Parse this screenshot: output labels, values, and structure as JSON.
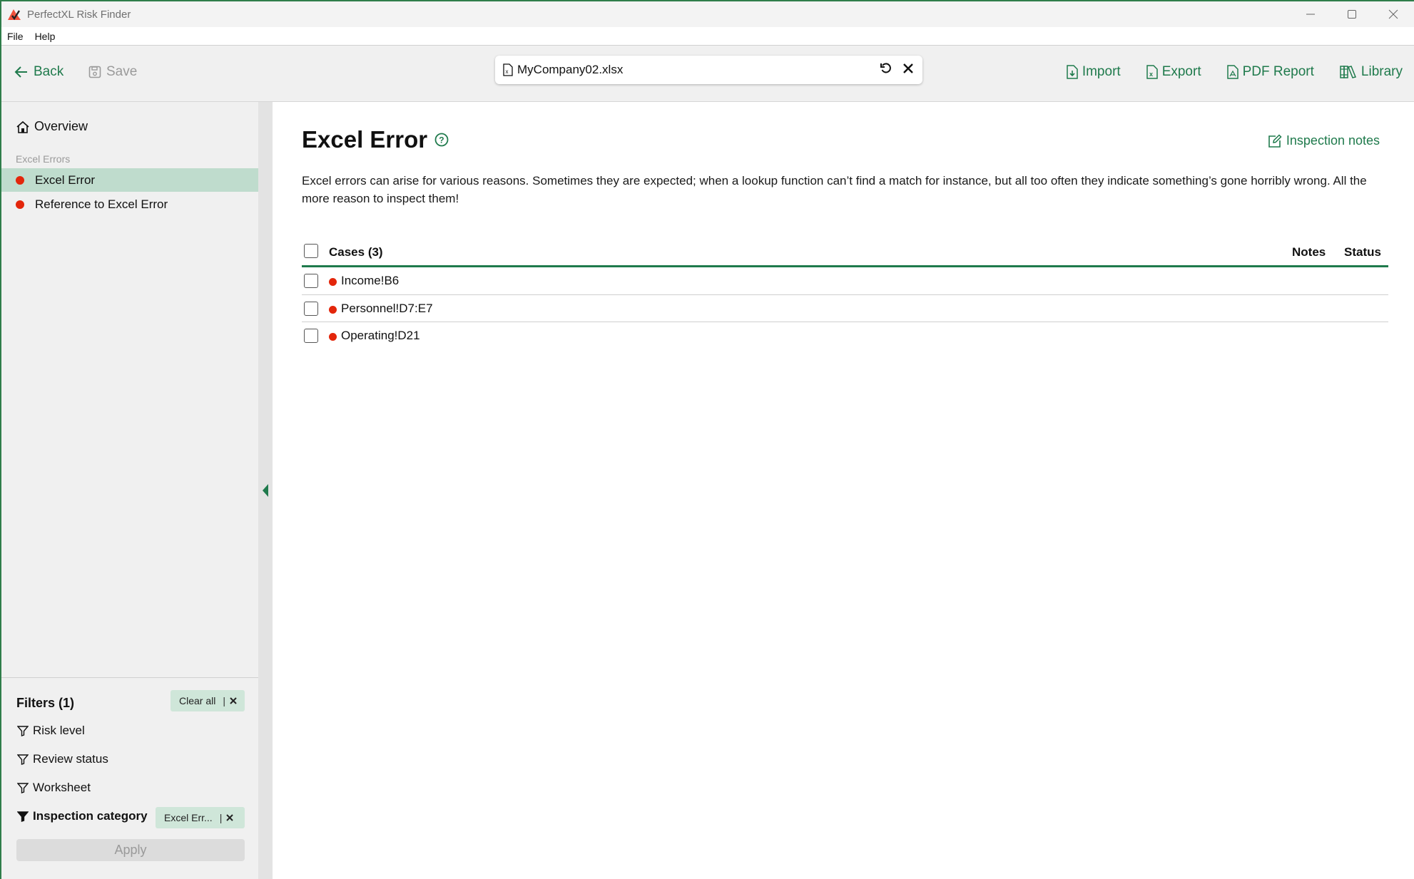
{
  "window": {
    "title": "PerfectXL Risk Finder",
    "controls": [
      "minimize",
      "maximize",
      "close"
    ]
  },
  "menu": {
    "items": [
      "File",
      "Help"
    ]
  },
  "toolbar": {
    "back_label": "Back",
    "save_label": "Save",
    "file_name": "MyCompany02.xlsx",
    "actions": {
      "import": "Import",
      "export": "Export",
      "pdf_report": "PDF Report",
      "library": "Library"
    }
  },
  "sidebar": {
    "overview_label": "Overview",
    "group_label": "Excel Errors",
    "items": [
      {
        "label": "Excel Error",
        "active": true,
        "risk_color": "#e3260b"
      },
      {
        "label": "Reference to Excel Error",
        "active": false,
        "risk_color": "#e3260b"
      }
    ],
    "filters": {
      "title": "Filters (1)",
      "clear_all_label": "Clear all",
      "rows": [
        {
          "label": "Risk level",
          "active": false
        },
        {
          "label": "Review status",
          "active": false
        },
        {
          "label": "Worksheet",
          "active": false
        },
        {
          "label": "Inspection category",
          "active": true,
          "chip": "Excel Err..."
        }
      ],
      "apply_label": "Apply"
    }
  },
  "main": {
    "title": "Excel Error",
    "inspection_notes_label": "Inspection notes",
    "description": "Excel errors can arise for various reasons. Sometimes they are expected; when a lookup function can’t find a match for instance, but all too often they indicate something’s gone horribly wrong. All the more reason to inspect them!",
    "table": {
      "header_cases": "Cases (3)",
      "header_notes": "Notes",
      "header_status": "Status",
      "rows": [
        {
          "ref": "Income!B6",
          "checked": false
        },
        {
          "ref": "Personnel!D7:E7",
          "checked": false
        },
        {
          "ref": "Operating!D21",
          "checked": false
        }
      ]
    }
  },
  "colors": {
    "accent": "#1f7a4c",
    "active_nav": "#bfdccd",
    "chip_bg": "#cfe6d9",
    "risk_high": "#e3260b"
  }
}
